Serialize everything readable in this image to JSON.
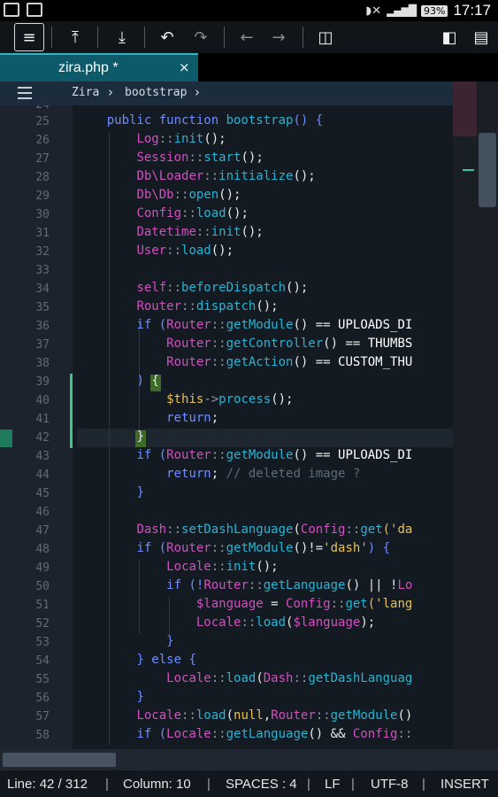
{
  "status_bar": {
    "battery": "93%",
    "time": "17:17",
    "icons": [
      "gallery-icon",
      "document-icon",
      "mute-icon",
      "signal-icon",
      "battery-icon"
    ]
  },
  "toolbar": {
    "buttons": [
      "menu-icon",
      "upload-icon",
      "download-icon",
      "undo-icon",
      "redo-icon",
      "arrow-left-icon",
      "arrow-right-icon",
      "split-view-icon",
      "sidebar-icon",
      "save-icon"
    ]
  },
  "tab": {
    "filename": "zira.php *",
    "close": "×"
  },
  "breadcrumb": {
    "items": [
      "Zira",
      "bootstrap"
    ]
  },
  "editor": {
    "first_partial_line": "24",
    "lines": [
      {
        "n": "25",
        "tokens": [
          [
            "    ",
            "#e8e8e8"
          ],
          [
            "public function ",
            "#6f8cff"
          ],
          [
            "bootstrap",
            "#27b4d3"
          ],
          [
            "() {",
            "#6f8cff"
          ]
        ]
      },
      {
        "n": "26",
        "tokens": [
          [
            "        ",
            "#e8e8e8"
          ],
          [
            "Log",
            "#d34fc0"
          ],
          [
            "::",
            "#8c96a2"
          ],
          [
            "init",
            "#27b4d3"
          ],
          [
            "();",
            "#e8e8e8"
          ]
        ]
      },
      {
        "n": "27",
        "tokens": [
          [
            "        ",
            "#e8e8e8"
          ],
          [
            "Session",
            "#d34fc0"
          ],
          [
            "::",
            "#8c96a2"
          ],
          [
            "start",
            "#27b4d3"
          ],
          [
            "();",
            "#e8e8e8"
          ]
        ]
      },
      {
        "n": "28",
        "tokens": [
          [
            "        ",
            "#e8e8e8"
          ],
          [
            "Db\\Loader",
            "#d34fc0"
          ],
          [
            "::",
            "#8c96a2"
          ],
          [
            "initialize",
            "#27b4d3"
          ],
          [
            "();",
            "#e8e8e8"
          ]
        ]
      },
      {
        "n": "29",
        "tokens": [
          [
            "        ",
            "#e8e8e8"
          ],
          [
            "Db\\Db",
            "#d34fc0"
          ],
          [
            "::",
            "#8c96a2"
          ],
          [
            "open",
            "#27b4d3"
          ],
          [
            "();",
            "#e8e8e8"
          ]
        ]
      },
      {
        "n": "30",
        "tokens": [
          [
            "        ",
            "#e8e8e8"
          ],
          [
            "Config",
            "#d34fc0"
          ],
          [
            "::",
            "#8c96a2"
          ],
          [
            "load",
            "#27b4d3"
          ],
          [
            "();",
            "#e8e8e8"
          ]
        ]
      },
      {
        "n": "31",
        "tokens": [
          [
            "        ",
            "#e8e8e8"
          ],
          [
            "Datetime",
            "#d34fc0"
          ],
          [
            "::",
            "#8c96a2"
          ],
          [
            "init",
            "#27b4d3"
          ],
          [
            "();",
            "#e8e8e8"
          ]
        ]
      },
      {
        "n": "32",
        "tokens": [
          [
            "        ",
            "#e8e8e8"
          ],
          [
            "User",
            "#d34fc0"
          ],
          [
            "::",
            "#8c96a2"
          ],
          [
            "load",
            "#27b4d3"
          ],
          [
            "();",
            "#e8e8e8"
          ]
        ]
      },
      {
        "n": "33",
        "tokens": []
      },
      {
        "n": "34",
        "tokens": [
          [
            "        ",
            "#e8e8e8"
          ],
          [
            "self",
            "#d34fc0"
          ],
          [
            "::",
            "#8c96a2"
          ],
          [
            "beforeDispatch",
            "#27b4d3"
          ],
          [
            "();",
            "#e8e8e8"
          ]
        ]
      },
      {
        "n": "35",
        "tokens": [
          [
            "        ",
            "#e8e8e8"
          ],
          [
            "Router",
            "#d34fc0"
          ],
          [
            "::",
            "#8c96a2"
          ],
          [
            "dispatch",
            "#27b4d3"
          ],
          [
            "();",
            "#e8e8e8"
          ]
        ]
      },
      {
        "n": "36",
        "tokens": [
          [
            "        ",
            "#e8e8e8"
          ],
          [
            "if",
            "#6f8cff"
          ],
          [
            " (",
            "#6f8cff"
          ],
          [
            "Router",
            "#d34fc0"
          ],
          [
            "::",
            "#8c96a2"
          ],
          [
            "getModule",
            "#27b4d3"
          ],
          [
            "() == ",
            "#e8e8e8"
          ],
          [
            "UPLOADS_DI",
            "#ffffff"
          ]
        ]
      },
      {
        "n": "37",
        "tokens": [
          [
            "            ",
            "#e8e8e8"
          ],
          [
            "Router",
            "#d34fc0"
          ],
          [
            "::",
            "#8c96a2"
          ],
          [
            "getController",
            "#27b4d3"
          ],
          [
            "() == ",
            "#e8e8e8"
          ],
          [
            "THUMBS",
            "#ffffff"
          ]
        ]
      },
      {
        "n": "38",
        "tokens": [
          [
            "            ",
            "#e8e8e8"
          ],
          [
            "Router",
            "#d34fc0"
          ],
          [
            "::",
            "#8c96a2"
          ],
          [
            "getAction",
            "#27b4d3"
          ],
          [
            "() == ",
            "#e8e8e8"
          ],
          [
            "CUSTOM_THU",
            "#ffffff"
          ]
        ]
      },
      {
        "n": "39",
        "tokens": [
          [
            "        ",
            "#e8e8e8"
          ],
          [
            ")",
            "#6f8cff"
          ],
          [
            " ",
            "#e8e8e8"
          ],
          [
            "{",
            "#e8e8e8"
          ]
        ]
      },
      {
        "n": "40",
        "tokens": [
          [
            "            ",
            "#e8e8e8"
          ],
          [
            "$this",
            "#e6c15a"
          ],
          [
            "->",
            "#8c96a2"
          ],
          [
            "process",
            "#27b4d3"
          ],
          [
            "();",
            "#e8e8e8"
          ]
        ]
      },
      {
        "n": "41",
        "tokens": [
          [
            "            ",
            "#e8e8e8"
          ],
          [
            "return",
            "#6f8cff"
          ],
          [
            ";",
            "#e8e8e8"
          ]
        ]
      },
      {
        "n": "42",
        "tokens": [
          [
            "        ",
            "#e8e8e8"
          ],
          [
            "}",
            "#e8e8e8"
          ]
        ]
      },
      {
        "n": "43",
        "tokens": [
          [
            "        ",
            "#e8e8e8"
          ],
          [
            "if",
            "#6f8cff"
          ],
          [
            " (",
            "#6f8cff"
          ],
          [
            "Router",
            "#d34fc0"
          ],
          [
            "::",
            "#8c96a2"
          ],
          [
            "getModule",
            "#27b4d3"
          ],
          [
            "() == ",
            "#e8e8e8"
          ],
          [
            "UPLOADS_DI",
            "#ffffff"
          ]
        ]
      },
      {
        "n": "44",
        "tokens": [
          [
            "            ",
            "#e8e8e8"
          ],
          [
            "return",
            "#6f8cff"
          ],
          [
            "; ",
            "#e8e8e8"
          ],
          [
            "// deleted image ?",
            "#5d6b78"
          ]
        ]
      },
      {
        "n": "45",
        "tokens": [
          [
            "        ",
            "#e8e8e8"
          ],
          [
            "}",
            "#6f8cff"
          ]
        ]
      },
      {
        "n": "46",
        "tokens": []
      },
      {
        "n": "47",
        "tokens": [
          [
            "        ",
            "#e8e8e8"
          ],
          [
            "Dash",
            "#d34fc0"
          ],
          [
            "::",
            "#8c96a2"
          ],
          [
            "setDashLanguage",
            "#27b4d3"
          ],
          [
            "(",
            "#e8e8e8"
          ],
          [
            "Config",
            "#d34fc0"
          ],
          [
            "::",
            "#8c96a2"
          ],
          [
            "get",
            "#27b4d3"
          ],
          [
            "('da",
            "#e6c15a"
          ]
        ]
      },
      {
        "n": "48",
        "tokens": [
          [
            "        ",
            "#e8e8e8"
          ],
          [
            "if",
            "#6f8cff"
          ],
          [
            " (",
            "#6f8cff"
          ],
          [
            "Router",
            "#d34fc0"
          ],
          [
            "::",
            "#8c96a2"
          ],
          [
            "getModule",
            "#27b4d3"
          ],
          [
            "()!=",
            "#e8e8e8"
          ],
          [
            "'dash'",
            "#e6c15a"
          ],
          [
            ") {",
            "#6f8cff"
          ]
        ]
      },
      {
        "n": "49",
        "tokens": [
          [
            "            ",
            "#e8e8e8"
          ],
          [
            "Locale",
            "#d34fc0"
          ],
          [
            "::",
            "#8c96a2"
          ],
          [
            "init",
            "#27b4d3"
          ],
          [
            "();",
            "#e8e8e8"
          ]
        ]
      },
      {
        "n": "50",
        "tokens": [
          [
            "            ",
            "#e8e8e8"
          ],
          [
            "if",
            "#6f8cff"
          ],
          [
            " (!",
            "#6f8cff"
          ],
          [
            "Router",
            "#d34fc0"
          ],
          [
            "::",
            "#8c96a2"
          ],
          [
            "getLanguage",
            "#27b4d3"
          ],
          [
            "() || !",
            "#e8e8e8"
          ],
          [
            "Lo",
            "#d34fc0"
          ]
        ]
      },
      {
        "n": "51",
        "tokens": [
          [
            "                ",
            "#e8e8e8"
          ],
          [
            "$language",
            "#d34fc0"
          ],
          [
            " = ",
            "#e8e8e8"
          ],
          [
            "Config",
            "#d34fc0"
          ],
          [
            "::",
            "#8c96a2"
          ],
          [
            "get",
            "#27b4d3"
          ],
          [
            "('lang",
            "#e6c15a"
          ]
        ]
      },
      {
        "n": "52",
        "tokens": [
          [
            "                ",
            "#e8e8e8"
          ],
          [
            "Locale",
            "#d34fc0"
          ],
          [
            "::",
            "#8c96a2"
          ],
          [
            "load",
            "#27b4d3"
          ],
          [
            "(",
            "#e8e8e8"
          ],
          [
            "$language",
            "#d34fc0"
          ],
          [
            ");",
            "#e8e8e8"
          ]
        ]
      },
      {
        "n": "53",
        "tokens": [
          [
            "            ",
            "#e8e8e8"
          ],
          [
            "}",
            "#6f8cff"
          ]
        ]
      },
      {
        "n": "54",
        "tokens": [
          [
            "        ",
            "#e8e8e8"
          ],
          [
            "} else {",
            "#6f8cff"
          ]
        ]
      },
      {
        "n": "55",
        "tokens": [
          [
            "            ",
            "#e8e8e8"
          ],
          [
            "Locale",
            "#d34fc0"
          ],
          [
            "::",
            "#8c96a2"
          ],
          [
            "load",
            "#27b4d3"
          ],
          [
            "(",
            "#e8e8e8"
          ],
          [
            "Dash",
            "#d34fc0"
          ],
          [
            "::",
            "#8c96a2"
          ],
          [
            "getDashLanguag",
            "#27b4d3"
          ]
        ]
      },
      {
        "n": "56",
        "tokens": [
          [
            "        ",
            "#e8e8e8"
          ],
          [
            "}",
            "#6f8cff"
          ]
        ]
      },
      {
        "n": "57",
        "tokens": [
          [
            "        ",
            "#e8e8e8"
          ],
          [
            "Locale",
            "#d34fc0"
          ],
          [
            "::",
            "#8c96a2"
          ],
          [
            "load",
            "#27b4d3"
          ],
          [
            "(",
            "#e8e8e8"
          ],
          [
            "null",
            "#e6c15a"
          ],
          [
            ",",
            "#e8e8e8"
          ],
          [
            "Router",
            "#d34fc0"
          ],
          [
            "::",
            "#8c96a2"
          ],
          [
            "getModule",
            "#27b4d3"
          ],
          [
            "()",
            "#e8e8e8"
          ]
        ]
      },
      {
        "n": "58",
        "tokens": [
          [
            "        ",
            "#e8e8e8"
          ],
          [
            "if",
            "#6f8cff"
          ],
          [
            " (",
            "#6f8cff"
          ],
          [
            "Locale",
            "#d34fc0"
          ],
          [
            "::",
            "#8c96a2"
          ],
          [
            "getLanguage",
            "#27b4d3"
          ],
          [
            "() && ",
            "#e8e8e8"
          ],
          [
            "Config",
            "#d34fc0"
          ],
          [
            "::",
            "#8c96a2"
          ]
        ]
      }
    ]
  },
  "status_line": {
    "line": "Line: 42 / 312",
    "column": "Column: 10",
    "indent": "SPACES : 4",
    "eol": "LF",
    "encoding": "UTF-8",
    "mode": "INSERT"
  }
}
